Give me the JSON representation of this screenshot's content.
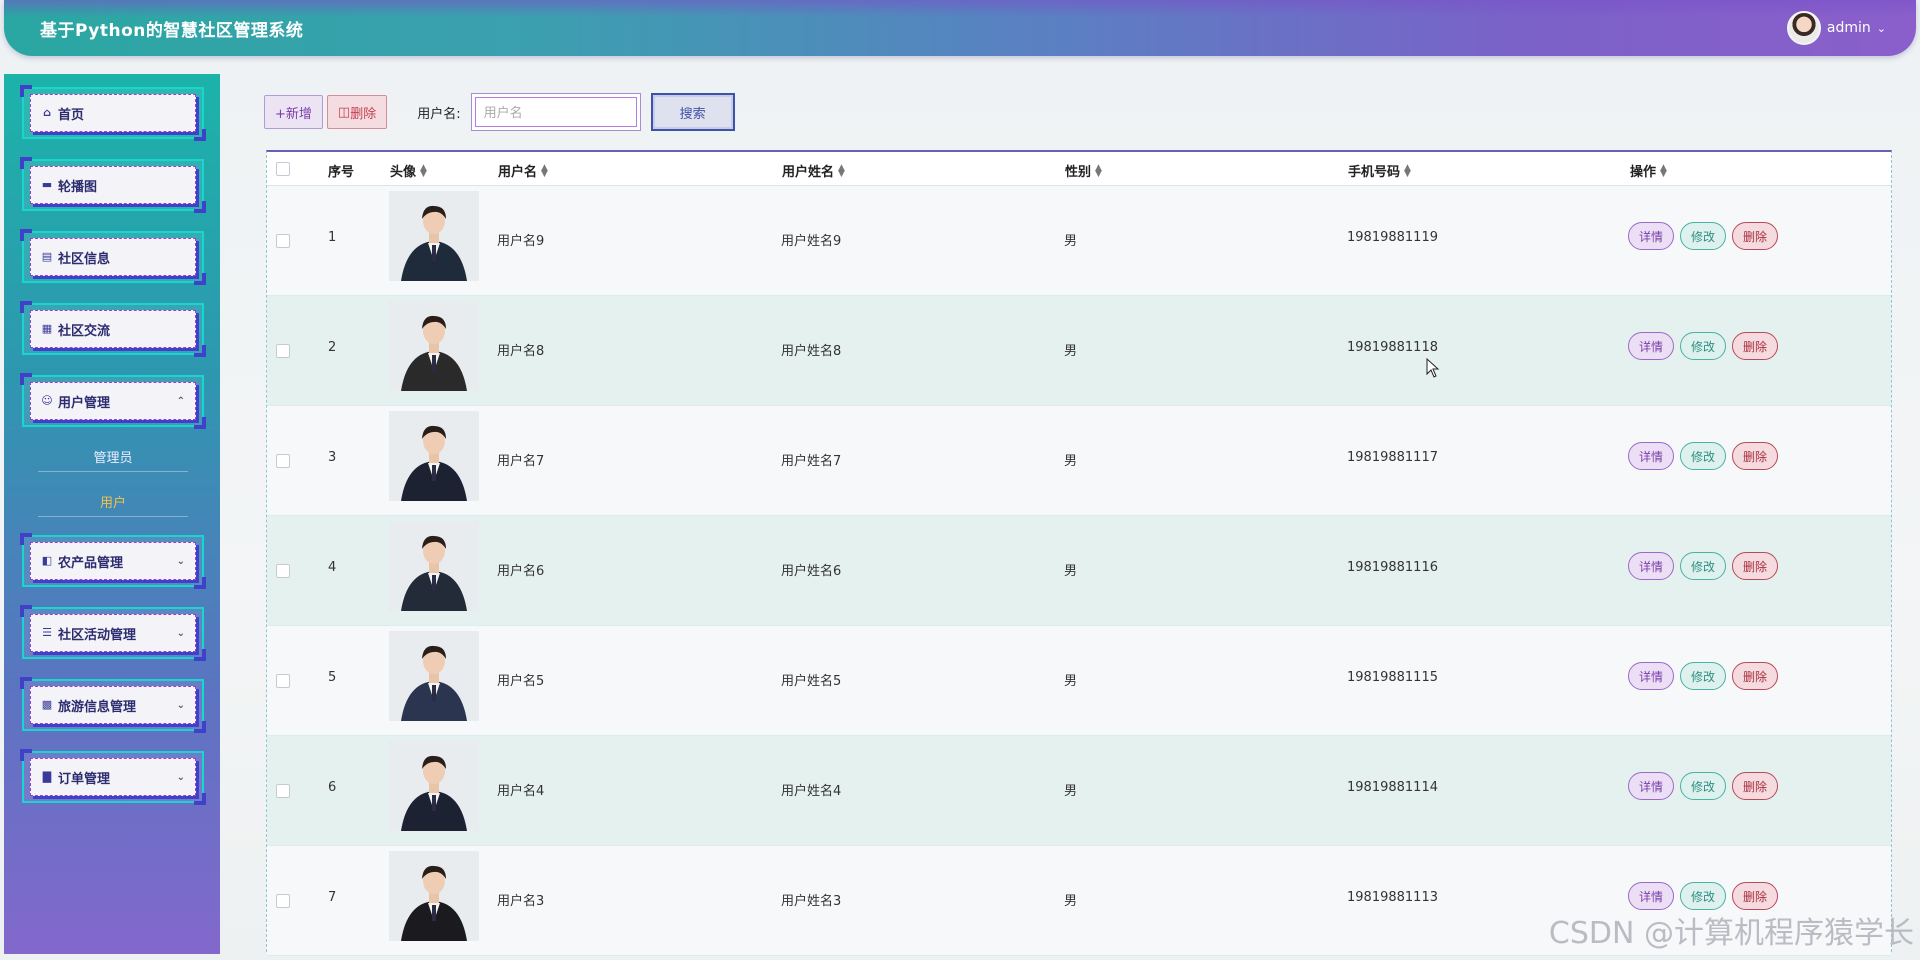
{
  "header": {
    "title": "基于Python的智慧社区管理系统",
    "username": "admin"
  },
  "sidebar": {
    "items": [
      {
        "label": "首页",
        "icon": "home-icon",
        "arrow": ""
      },
      {
        "label": "轮播图",
        "icon": "image-icon",
        "arrow": ""
      },
      {
        "label": "社区信息",
        "icon": "building-icon",
        "arrow": ""
      },
      {
        "label": "社区交流",
        "icon": "grid-icon",
        "arrow": ""
      },
      {
        "label": "用户管理",
        "icon": "user-icon",
        "arrow": "^"
      },
      {
        "label": "农产品管理",
        "icon": "box-icon",
        "arrow": "v"
      },
      {
        "label": "社区活动管理",
        "icon": "list-icon",
        "arrow": "v"
      },
      {
        "label": "旅游信息管理",
        "icon": "tiles-icon",
        "arrow": "v"
      },
      {
        "label": "订单管理",
        "icon": "chart-icon",
        "arrow": "v"
      }
    ],
    "subitems": [
      {
        "label": "管理员",
        "active": false
      },
      {
        "label": "用户",
        "active": true
      }
    ]
  },
  "toolbar": {
    "add_label": "+新增",
    "delete_label": "删除",
    "search_label": "用户名:",
    "search_placeholder": "用户名",
    "search_button": "搜索"
  },
  "table": {
    "headers": {
      "index": "序号",
      "avatar": "头像",
      "username": "用户名",
      "realname": "用户姓名",
      "gender": "性别",
      "phone": "手机号码",
      "actions": "操作"
    },
    "action_labels": {
      "detail": "详情",
      "edit": "修改",
      "remove": "删除"
    },
    "rows": [
      {
        "index": "1",
        "username": "用户名9",
        "realname": "用户姓名9",
        "gender": "男",
        "phone": "19819881119"
      },
      {
        "index": "2",
        "username": "用户名8",
        "realname": "用户姓名8",
        "gender": "男",
        "phone": "19819881118"
      },
      {
        "index": "3",
        "username": "用户名7",
        "realname": "用户姓名7",
        "gender": "男",
        "phone": "19819881117"
      },
      {
        "index": "4",
        "username": "用户名6",
        "realname": "用户姓名6",
        "gender": "男",
        "phone": "19819881116"
      },
      {
        "index": "5",
        "username": "用户名5",
        "realname": "用户姓名5",
        "gender": "男",
        "phone": "19819881115"
      },
      {
        "index": "6",
        "username": "用户名4",
        "realname": "用户姓名4",
        "gender": "男",
        "phone": "19819881114"
      },
      {
        "index": "7",
        "username": "用户名3",
        "realname": "用户姓名3",
        "gender": "男",
        "phone": "19819881113"
      }
    ]
  },
  "watermark": "CSDN @计算机程序猿学长",
  "colors": {
    "accent_teal": "#1cb3a9",
    "accent_purple": "#8368cc",
    "detail": "#7a3faa",
    "edit": "#2f8f83",
    "remove": "#a8303f"
  }
}
